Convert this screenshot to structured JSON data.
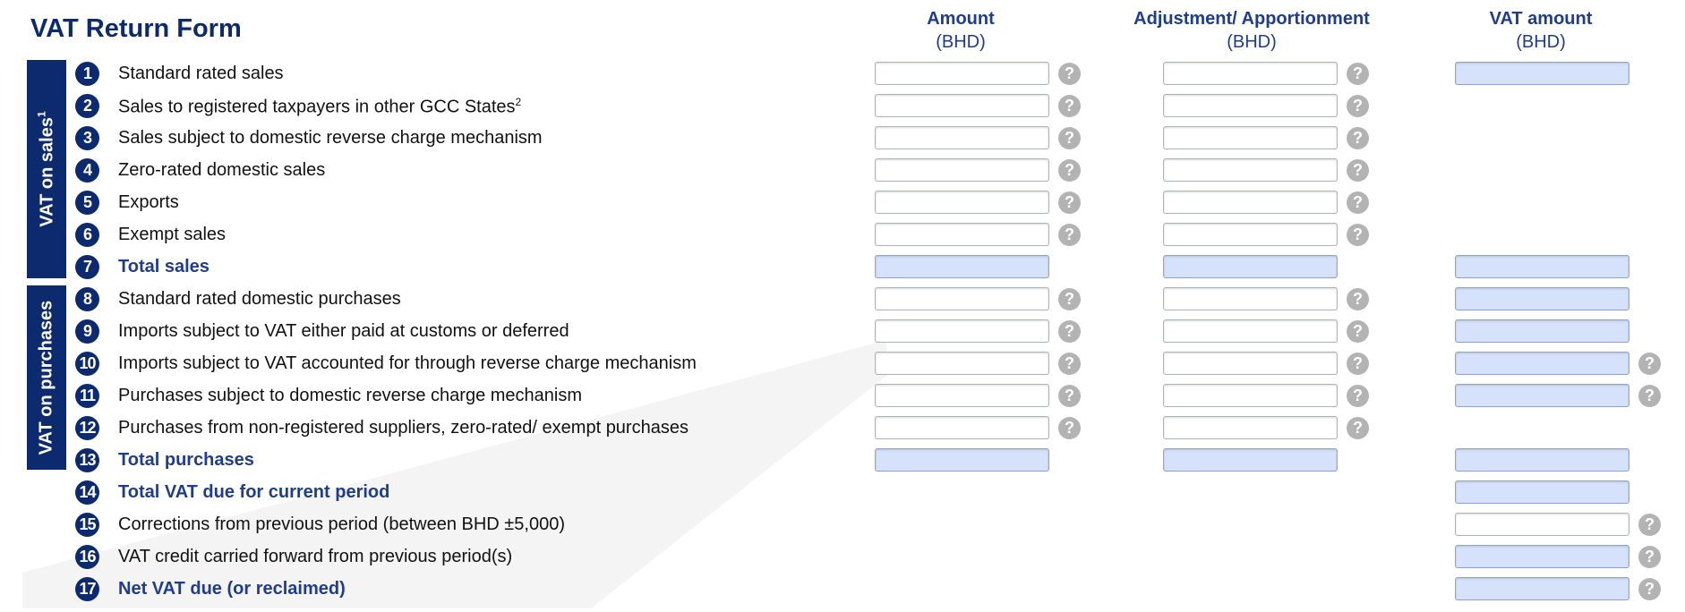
{
  "form": {
    "title": "VAT Return Form",
    "columns": [
      {
        "title": "Amount",
        "unit": "(BHD)"
      },
      {
        "title": "Adjustment/ Apportionment",
        "unit": "(BHD)"
      },
      {
        "title": "VAT amount",
        "unit": "(BHD)"
      }
    ],
    "sections": {
      "sales": {
        "label": "VAT on sales",
        "footnote": "1"
      },
      "purchases": {
        "label": "VAT on purchases"
      }
    },
    "help_glyph": "?",
    "rows": [
      {
        "num": "1",
        "label": "Standard rated sales",
        "footnote": "",
        "total": false
      },
      {
        "num": "2",
        "label": "Sales to registered taxpayers in other GCC States",
        "footnote": "2",
        "total": false
      },
      {
        "num": "3",
        "label": "Sales subject to domestic reverse charge mechanism",
        "footnote": "",
        "total": false
      },
      {
        "num": "4",
        "label": "Zero-rated domestic sales",
        "footnote": "",
        "total": false
      },
      {
        "num": "5",
        "label": "Exports",
        "footnote": "",
        "total": false
      },
      {
        "num": "6",
        "label": "Exempt sales",
        "footnote": "",
        "total": false
      },
      {
        "num": "7",
        "label": "Total sales",
        "footnote": "",
        "total": true
      },
      {
        "num": "8",
        "label": "Standard rated domestic purchases",
        "footnote": "",
        "total": false
      },
      {
        "num": "9",
        "label": "Imports subject to VAT either paid at customs or deferred",
        "footnote": "",
        "total": false
      },
      {
        "num": "10",
        "label": "Imports subject to VAT accounted for through reverse charge mechanism",
        "footnote": "",
        "total": false
      },
      {
        "num": "11",
        "label": "Purchases subject to domestic reverse charge mechanism",
        "footnote": "",
        "total": false
      },
      {
        "num": "12",
        "label": "Purchases from non-registered suppliers, zero-rated/ exempt purchases",
        "footnote": "",
        "total": false
      },
      {
        "num": "13",
        "label": "Total purchases",
        "footnote": "",
        "total": true
      },
      {
        "num": "14",
        "label": "Total VAT due for current period",
        "footnote": "",
        "total": true
      },
      {
        "num": "15",
        "label": "Corrections from previous period (between BHD ±5,000)",
        "footnote": "",
        "total": false
      },
      {
        "num": "16",
        "label": "VAT credit carried forward from previous period(s)",
        "footnote": "",
        "total": false
      },
      {
        "num": "17",
        "label": "Net VAT due (or reclaimed)",
        "footnote": "",
        "total": true
      }
    ]
  },
  "colors": {
    "brand_navy": "#0d2a6e",
    "header_blue": "#1f3d8a",
    "calculated_field": "#d6e2fb",
    "help_icon": "#b3b3b3"
  }
}
